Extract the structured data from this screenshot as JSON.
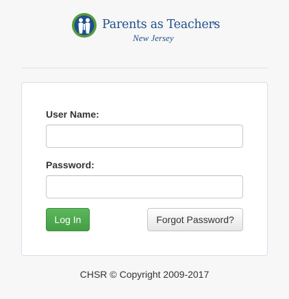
{
  "logo": {
    "icon": "parents-as-teachers-logo-icon",
    "title": "Parents as Teachers",
    "trademark": "®",
    "subtitle": "New Jersey",
    "colors": {
      "brand_blue": "#1f4f8b",
      "brand_green": "#5a9a3c"
    }
  },
  "form": {
    "username_label": "User Name:",
    "username_value": "",
    "username_placeholder": "",
    "password_label": "Password:",
    "password_value": "",
    "password_placeholder": "",
    "login_label": "Log In",
    "forgot_label": "Forgot Password?",
    "colors": {
      "login_button": "#5cb85c",
      "panel_border": "#d5dfe9"
    }
  },
  "footer": {
    "text": "CHSR © Copyright 2009-2017"
  }
}
